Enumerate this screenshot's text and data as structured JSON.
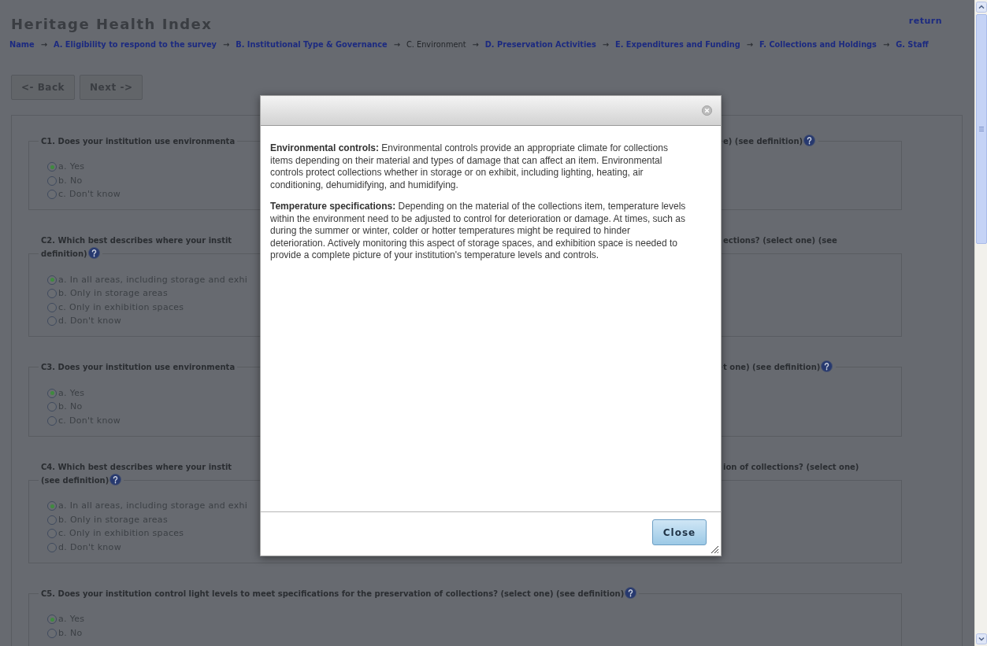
{
  "page": {
    "title": "Heritage Health Index",
    "return_link": "return",
    "breadcrumb": [
      {
        "kind": "link",
        "label": "Name",
        "selected": false
      },
      {
        "kind": "arrow",
        "label": "→"
      },
      {
        "kind": "link",
        "label": "A. Eligibility to respond to the survey",
        "selected": false
      },
      {
        "kind": "arrow",
        "label": "→"
      },
      {
        "kind": "link",
        "label": "B. Institutional Type & Governance",
        "selected": false
      },
      {
        "kind": "arrow",
        "label": "→"
      },
      {
        "kind": "link",
        "label": "C. Environment",
        "selected": true
      },
      {
        "kind": "arrow",
        "label": "→"
      },
      {
        "kind": "link",
        "label": "D. Preservation Activities",
        "selected": false
      },
      {
        "kind": "arrow",
        "label": "→"
      },
      {
        "kind": "link",
        "label": "E. Expenditures and Funding",
        "selected": false
      },
      {
        "kind": "arrow",
        "label": "→"
      },
      {
        "kind": "link",
        "label": "F. Collections and Holdings",
        "selected": false
      },
      {
        "kind": "arrow",
        "label": "→"
      },
      {
        "kind": "link",
        "label": "G. Staff",
        "selected": false
      }
    ],
    "buttons": [
      "<- Back",
      "Next ->"
    ]
  },
  "questions": [
    {
      "title_left": [
        "C1. Does your institution use environmenta"
      ],
      "title_right": "e) (see definition)",
      "help_left": false,
      "help_right": true,
      "options": [
        {
          "label": "a. Yes",
          "selected": true
        },
        {
          "label": "b. No",
          "selected": false
        },
        {
          "label": "c. Don't know",
          "selected": false
        }
      ]
    },
    {
      "title_left": [
        "C2. Which best describes where your instit",
        "definition)"
      ],
      "title_right": "ections? (select one) (see",
      "help_left": true,
      "help_right": false,
      "options": [
        {
          "label": "a. In all areas, including storage and exhi",
          "selected": true
        },
        {
          "label": "b. Only in storage areas",
          "selected": false
        },
        {
          "label": "c. Only in exhibition spaces",
          "selected": false
        },
        {
          "label": "d. Don't know",
          "selected": false
        }
      ]
    },
    {
      "title_left": [
        "C3. Does your institution use environmenta"
      ],
      "title_right": "t one) (see definition)",
      "help_left": false,
      "help_right": true,
      "options": [
        {
          "label": "a. Yes",
          "selected": true
        },
        {
          "label": "b. No",
          "selected": false
        },
        {
          "label": "c. Don't know",
          "selected": false
        }
      ]
    },
    {
      "title_left": [
        "C4. Which best describes where your instit",
        "(see definition)"
      ],
      "title_right": "ion of collections? (select one)",
      "help_left": true,
      "help_right": false,
      "options": [
        {
          "label": "a. In all areas, including storage and exhi",
          "selected": true
        },
        {
          "label": "b. Only in storage areas",
          "selected": false
        },
        {
          "label": "c. Only in exhibition spaces",
          "selected": false
        },
        {
          "label": "d. Don't know",
          "selected": false
        }
      ]
    },
    {
      "title_left": [
        "C5. Does your institution control light levels to meet specifications for the preservation of collections? (select one) (see definition)"
      ],
      "help_left": true,
      "options": [
        {
          "label": "a. Yes",
          "selected": true
        },
        {
          "label": "b. No",
          "selected": false
        }
      ]
    }
  ],
  "dialog": {
    "paragraphs": [
      "**Environmental controls:** Environmental controls provide an appropriate climate for collections items depending on their material and types of damage that can affect an item. Environmental controls protect collections whether in storage or on exhibit, including lighting, heating, air conditioning, dehumidifying, and humidifying.",
      "**Temperature specifications:** Depending on the material of the collections item, temperature levels within the environment need to be adjusted to control for deterioration or damage. At times, such as during the summer or winter, colder or hotter temperatures might be required to hinder deterioration. Actively monitoring this aspect of storage spaces, and exhibition space is needed to provide a complete picture of your institution's temperature levels and controls."
    ],
    "button": "Close"
  }
}
